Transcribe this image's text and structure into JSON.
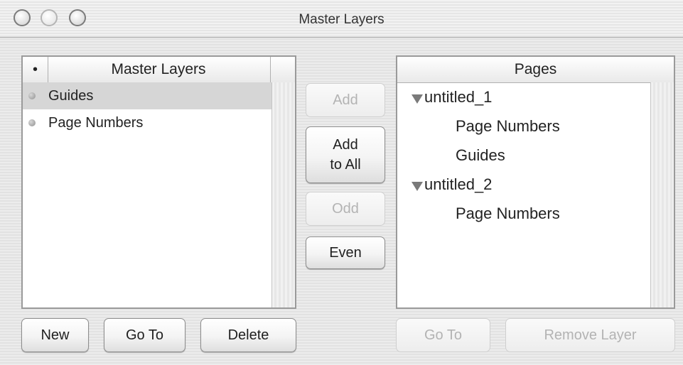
{
  "window": {
    "title": "Master Layers"
  },
  "left_panel": {
    "header_dot": "•",
    "header_title": "Master Layers",
    "items": [
      {
        "label": "Guides",
        "selected": true
      },
      {
        "label": "Page Numbers",
        "selected": false
      }
    ]
  },
  "middle_buttons": {
    "add": "Add",
    "add_to_all": "Add\nto All",
    "odd": "Odd",
    "even": "Even"
  },
  "right_panel": {
    "header_title": "Pages",
    "pages": [
      {
        "label": "untitled_1",
        "expanded": true,
        "children": [
          "Page Numbers",
          "Guides"
        ]
      },
      {
        "label": "untitled_2",
        "expanded": true,
        "children": [
          "Page Numbers"
        ]
      }
    ]
  },
  "bottom_buttons": {
    "new": "New",
    "go_to_left": "Go To",
    "delete": "Delete",
    "go_to_right": "Go To",
    "remove_layer": "Remove Layer"
  }
}
